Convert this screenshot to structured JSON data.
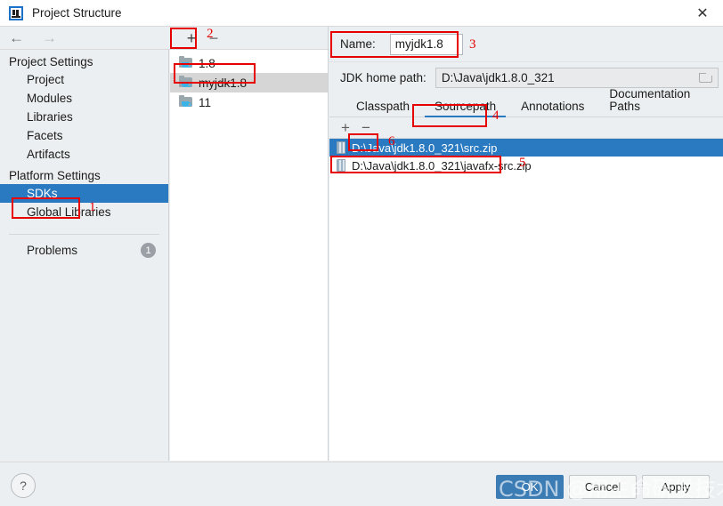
{
  "window": {
    "title": "Project Structure",
    "app_icon": "intellij-idea-icon",
    "close_label": "✕"
  },
  "toolbar": {
    "back_icon": "←",
    "forward_icon": "→"
  },
  "sidebar": {
    "groups": [
      {
        "label": "Project Settings",
        "items": [
          {
            "label": "Project",
            "selected": false
          },
          {
            "label": "Modules",
            "selected": false
          },
          {
            "label": "Libraries",
            "selected": false
          },
          {
            "label": "Facets",
            "selected": false
          },
          {
            "label": "Artifacts",
            "selected": false
          }
        ]
      },
      {
        "label": "Platform Settings",
        "items": [
          {
            "label": "SDKs",
            "selected": true
          },
          {
            "label": "Global Libraries",
            "selected": false
          }
        ]
      }
    ],
    "problems": {
      "label": "Problems",
      "count": "1"
    }
  },
  "sdk_panel": {
    "add_label": "+",
    "remove_label": "−",
    "items": [
      {
        "label": "1.8",
        "selected": false
      },
      {
        "label": "myjdk1.8",
        "selected": true
      },
      {
        "label": "11",
        "selected": false
      }
    ]
  },
  "detail": {
    "name_label": "Name:",
    "name_value": "myjdk1.8",
    "name_placeholder": "",
    "jdk_path_label": "JDK home path:",
    "jdk_path_value": "D:\\Java\\jdk1.8.0_321",
    "browse_icon": "folder-icon",
    "tabs": [
      {
        "label": "Classpath",
        "active": false
      },
      {
        "label": "Sourcepath",
        "active": true
      },
      {
        "label": "Annotations",
        "active": false
      },
      {
        "label": "Documentation Paths",
        "active": false
      }
    ],
    "path_toolbar": {
      "add_label": "+",
      "remove_label": "−"
    },
    "paths": [
      {
        "label": "D:\\Java\\jdk1.8.0_321\\src.zip",
        "selected": true
      },
      {
        "label": "D:\\Java\\jdk1.8.0_321\\javafx-src.zip",
        "selected": false
      }
    ]
  },
  "bottom": {
    "help_label": "?",
    "ok_label": "OK",
    "cancel_label": "Cancel",
    "apply_label": "Apply"
  },
  "annotations": [
    {
      "num": "1"
    },
    {
      "num": "2"
    },
    {
      "num": "3"
    },
    {
      "num": "4"
    },
    {
      "num": "5"
    },
    {
      "num": "6"
    }
  ],
  "watermark": {
    "text": "CSDN @用生命研发技术"
  },
  "colors": {
    "accent_blue": "#2a7ac1",
    "primary_button": "#3b7cb5",
    "annotation_red": "#e60000",
    "panel_bg": "#eceff1",
    "list_bg": "#ffffff"
  }
}
